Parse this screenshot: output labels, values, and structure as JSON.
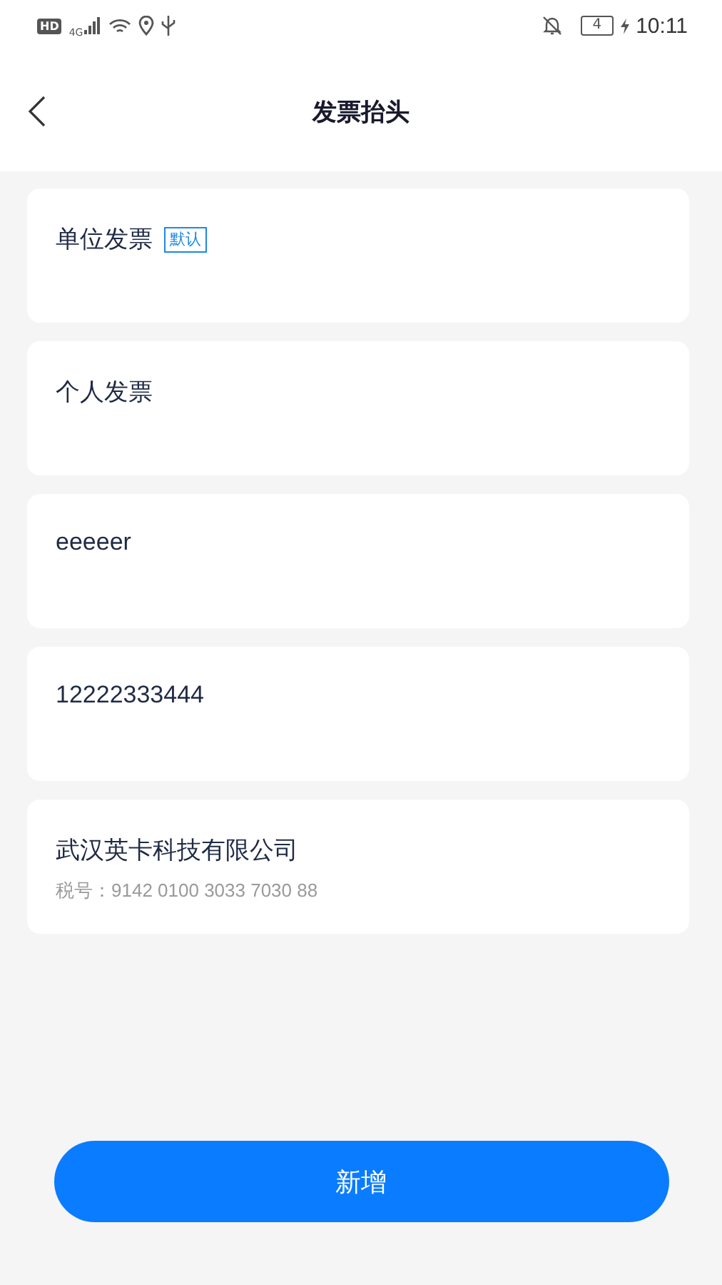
{
  "status_bar": {
    "hd": "HD",
    "network": "4G",
    "battery": "4",
    "time": "10:11"
  },
  "header": {
    "title": "发票抬头"
  },
  "invoices": [
    {
      "name": "单位发票",
      "tag": "默认"
    },
    {
      "name": "个人发票"
    },
    {
      "name": "eeeeer"
    },
    {
      "name": "12222333444"
    },
    {
      "name": "武汉英卡科技有限公司",
      "tax_number": "税号：9142 0100 3033 7030 88"
    }
  ],
  "add_button": "新增"
}
